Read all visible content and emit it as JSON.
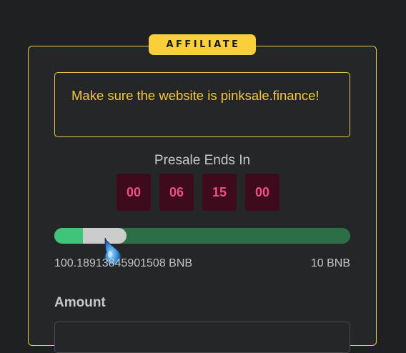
{
  "badge": {
    "label": "AFFILIATE"
  },
  "notice": {
    "text": "Make sure the website is pinksale.finance!"
  },
  "presale": {
    "title": "Presale Ends In",
    "countdown": [
      "00",
      "06",
      "15",
      "00"
    ]
  },
  "progress": {
    "fraction": 0.245,
    "left_label": "100.18913845901508 BNB",
    "right_label": "10 BNB"
  },
  "amount": {
    "label": "Amount"
  },
  "colors": {
    "accent": "#f7d03a",
    "countdown_text": "#f34f86",
    "progress_bar": "#2c6e45"
  },
  "icons": {
    "drop": "water-drop-icon"
  }
}
